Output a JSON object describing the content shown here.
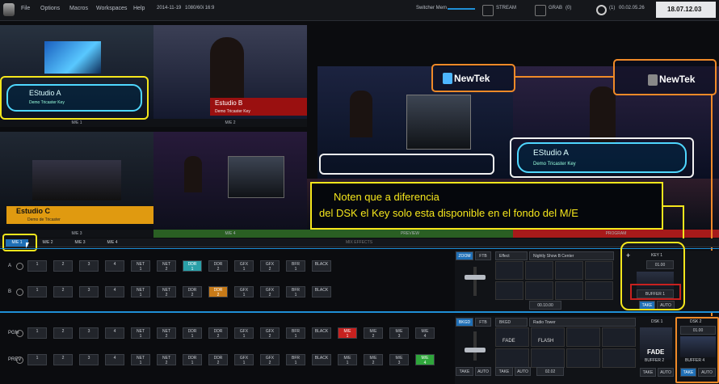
{
  "menubar": {
    "items": [
      "File",
      "Options",
      "Macros",
      "Workspaces",
      "Help"
    ],
    "date": "2014-11-19",
    "format": "1080/60i 16:9",
    "switcher_mem": "Switcher Mem",
    "stream": "STREAM",
    "grab": "GRAB",
    "grab_count": "(0)",
    "record_count": "(1)",
    "timecode": "00.02.05.26",
    "clock": "18.07.12.03"
  },
  "monitors": {
    "me1": "M/E 1",
    "me2": "M/E 2",
    "me3": "M/E 3",
    "me4": "M/E 4",
    "preview": "PREVIEW",
    "program": "PROGRAM"
  },
  "slides": {
    "studio_a": "EStudio A",
    "demo_key": "Demo Tricaster Key",
    "studio_b": "Estudio B",
    "demo_b": "Demo Tricaster Key",
    "studio_c": "Estudio C",
    "demo_c": "Demo de Tricaster",
    "newtek1": "NewTek",
    "newtek2": "NewTek",
    "studio_a2": "EStudio A",
    "demo_a2": "Demo Tricaster Key"
  },
  "annotation": {
    "line1": "Noten que a diferencia",
    "line2": "del DSK el Key solo esta disponible en el fondo del M/E"
  },
  "me_tabs": [
    "M/E 1",
    "M/E 2",
    "M/E 3",
    "M/E 4"
  ],
  "mix_effects": "MIX EFFECTS",
  "row_a": {
    "label": "A",
    "buttons": [
      [
        "1",
        ""
      ],
      [
        "2",
        ""
      ],
      [
        "3",
        ""
      ],
      [
        "4",
        ""
      ],
      [
        "NET",
        "1"
      ],
      [
        "NET",
        "2"
      ],
      [
        "DDR",
        "1"
      ],
      [
        "DDR",
        "2"
      ],
      [
        "GFX",
        "1"
      ],
      [
        "GFX",
        "2"
      ],
      [
        "BFR",
        "1"
      ],
      [
        "BLACK",
        ""
      ]
    ]
  },
  "row_b": {
    "label": "B",
    "buttons": [
      [
        "1",
        ""
      ],
      [
        "2",
        ""
      ],
      [
        "3",
        ""
      ],
      [
        "4",
        ""
      ],
      [
        "NET",
        "1"
      ],
      [
        "NET",
        "2"
      ],
      [
        "DDR",
        "2"
      ],
      [
        "DDR",
        "2"
      ],
      [
        "GFX",
        "1"
      ],
      [
        "GFX",
        "2"
      ],
      [
        "BFR",
        "1"
      ],
      [
        "BLACK",
        ""
      ]
    ]
  },
  "row_pgm": {
    "label": "PGM",
    "buttons": [
      [
        "1",
        ""
      ],
      [
        "2",
        ""
      ],
      [
        "3",
        ""
      ],
      [
        "4",
        ""
      ],
      [
        "NET",
        "1"
      ],
      [
        "NET",
        "2"
      ],
      [
        "DDR",
        "1"
      ],
      [
        "DDR",
        "2"
      ],
      [
        "GFX",
        "1"
      ],
      [
        "GFX",
        "2"
      ],
      [
        "BFR",
        "1"
      ],
      [
        "BLACK",
        ""
      ],
      [
        "M/E",
        "1"
      ],
      [
        "M/E",
        "2"
      ],
      [
        "M/E",
        "3"
      ],
      [
        "M/E",
        "4"
      ]
    ]
  },
  "row_prev": {
    "label": "PREV",
    "buttons": [
      [
        "1",
        ""
      ],
      [
        "2",
        ""
      ],
      [
        "3",
        ""
      ],
      [
        "4",
        ""
      ],
      [
        "NET",
        "1"
      ],
      [
        "NET",
        "2"
      ],
      [
        "DDR",
        "1"
      ],
      [
        "DDR",
        "2"
      ],
      [
        "GFX",
        "1"
      ],
      [
        "GFX",
        "2"
      ],
      [
        "BFR",
        "1"
      ],
      [
        "BLACK",
        ""
      ],
      [
        "M/E",
        "1"
      ],
      [
        "M/E",
        "2"
      ],
      [
        "M/E",
        "3"
      ],
      [
        "M/E",
        "4"
      ]
    ]
  },
  "me_panel": {
    "zoom": "ZOOM",
    "ftb": "FTB",
    "effect": "Effect",
    "preset": "Nightly Show B Center",
    "time": "00.10.00",
    "take": "TAKE",
    "auto": "AUTO",
    "key1": "KEY 1",
    "key_time": "01.00",
    "buffer1": "BUFFER 1",
    "take2": "TAKE",
    "auto2": "AUTO"
  },
  "main_panel": {
    "bkgd": "BKGD",
    "ftb": "FTB",
    "bkgd2": "BKGD",
    "preset": "Radio Tower",
    "fade": "FADE",
    "flash": "FLASH",
    "time": "02.02",
    "take": "TAKE",
    "auto": "AUTO",
    "dsk1": "DSK 1",
    "dsk2": "DSK 2",
    "dsk_time": "01.00",
    "fade2": "FADE",
    "buffer2": "BUFFER 2",
    "buffer4": "BUFFER 4",
    "take2": "TAKE",
    "auto2": "AUTO",
    "take3": "TAKE",
    "auto3": "AUTO"
  },
  "colors": {
    "accent": "#1f8fd6",
    "yellow": "#f5e61c",
    "orange": "#f08a28",
    "green": "#2fa63b",
    "red": "#c7211f"
  }
}
